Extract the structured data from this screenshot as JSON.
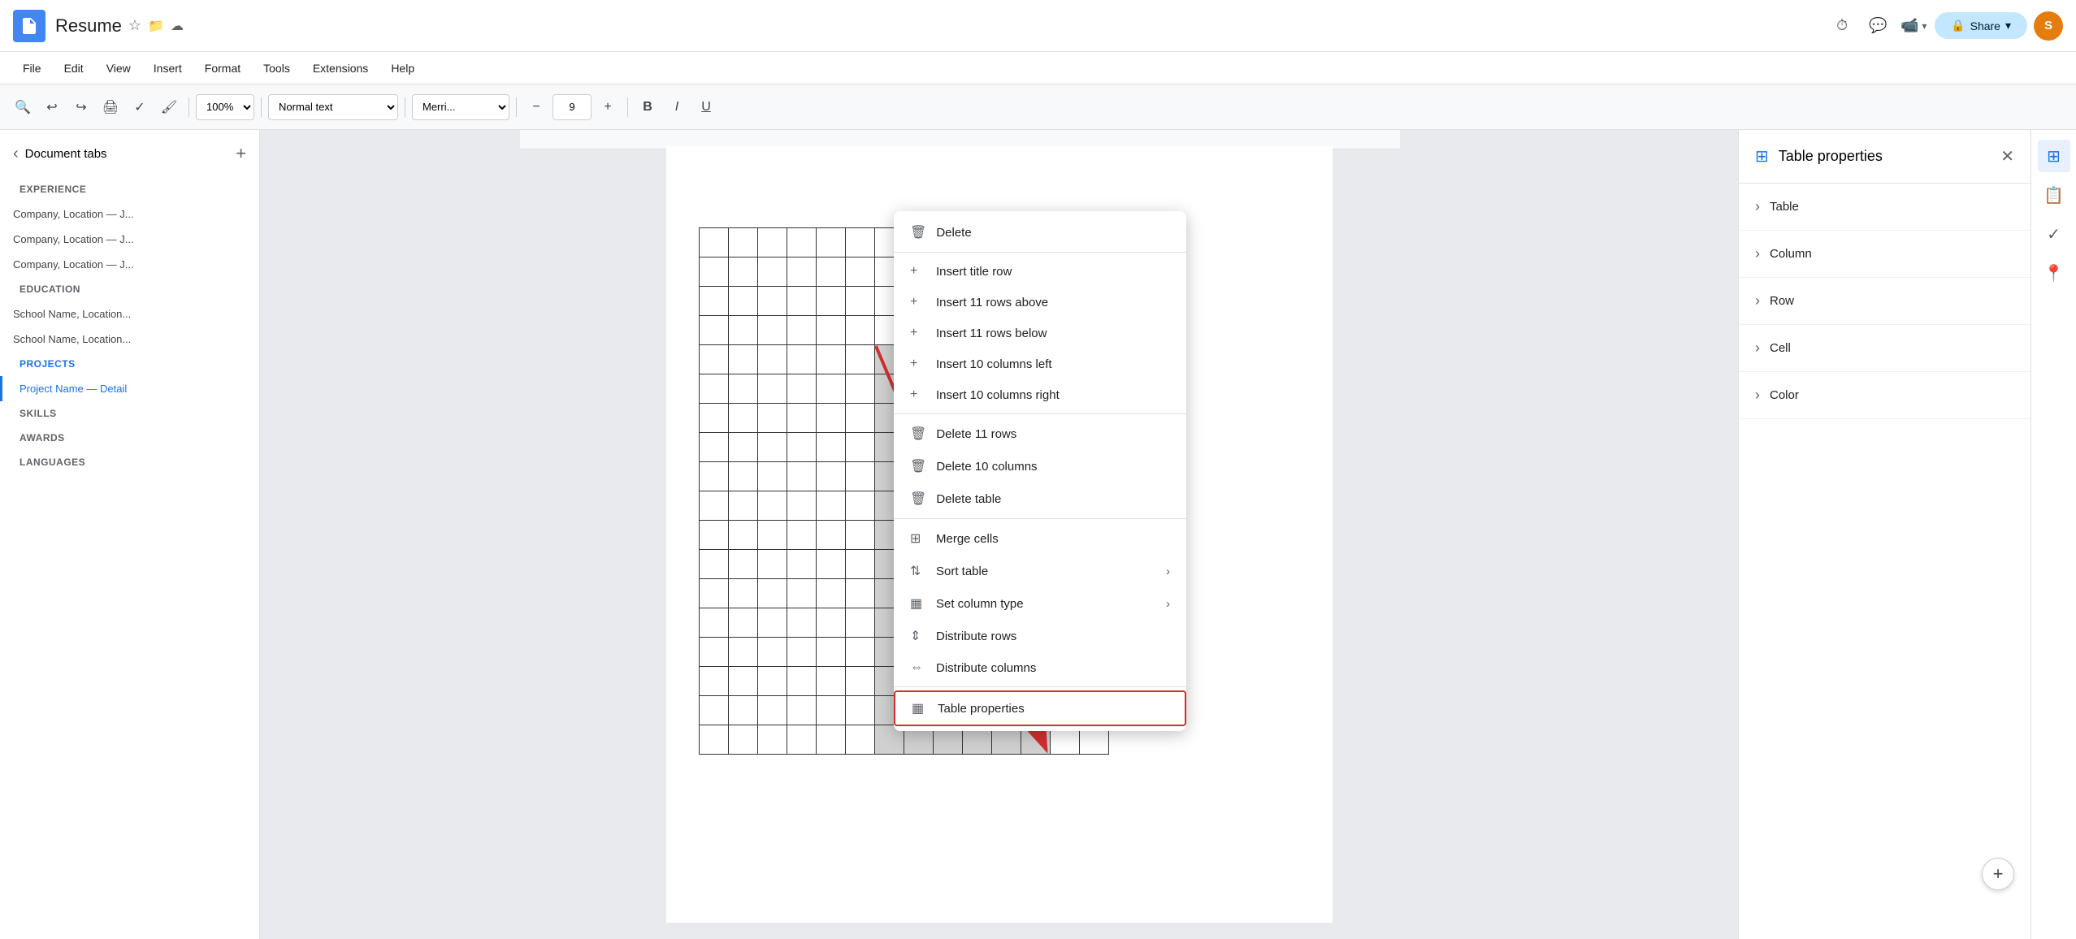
{
  "app": {
    "icon_label": "Google Docs",
    "doc_title": "Resume",
    "cloud_icon": "☁",
    "star_icon": "☆",
    "history_icon": "⊙"
  },
  "top_right": {
    "history_label": "⏱",
    "comment_label": "💬",
    "meet_label": "📹",
    "share_label": "Share",
    "share_dropdown": "▾",
    "avatar_label": "S"
  },
  "menu": {
    "items": [
      "File",
      "Edit",
      "View",
      "Insert",
      "Format",
      "Tools",
      "Extensions",
      "Help"
    ]
  },
  "toolbar": {
    "zoom_label": "100%",
    "style_label": "Normal text",
    "font_label": "Merri...",
    "font_size": "9",
    "bold_label": "B",
    "italic_label": "I",
    "underline_label": "U"
  },
  "sidebar": {
    "title": "Document tabs",
    "sections": [
      {
        "label": "EXPERIENCE",
        "items": [
          "Company, Location — J...",
          "Company, Location — J...",
          "Company, Location — J..."
        ]
      },
      {
        "label": "EDUCATION",
        "items": [
          "School Name, Location...",
          "School Name, Location..."
        ]
      },
      {
        "label": "PROJECTS",
        "items": [
          "Project Name — Detail"
        ],
        "active": true
      },
      {
        "label": "SKILLS",
        "items": []
      },
      {
        "label": "AWARDS",
        "items": []
      },
      {
        "label": "LANGUAGES",
        "items": []
      }
    ]
  },
  "context_menu": {
    "items": [
      {
        "id": "delete",
        "icon": "🗑",
        "label": "Delete",
        "arrow": false
      },
      {
        "id": "insert-title-row",
        "icon": "+",
        "label": "Insert title row",
        "arrow": false
      },
      {
        "id": "insert-rows-above",
        "icon": "+",
        "label": "Insert 11 rows above",
        "arrow": false
      },
      {
        "id": "insert-rows-below",
        "icon": "+",
        "label": "Insert 11 rows below",
        "arrow": false
      },
      {
        "id": "insert-cols-left",
        "icon": "+",
        "label": "Insert 10 columns left",
        "arrow": false
      },
      {
        "id": "insert-cols-right",
        "icon": "+",
        "label": "Insert 10 columns right",
        "arrow": false
      },
      {
        "id": "delete-11-rows",
        "icon": "🗑",
        "label": "Delete 11 rows",
        "arrow": false
      },
      {
        "id": "delete-10-cols",
        "icon": "🗑",
        "label": "Delete 10 columns",
        "arrow": false
      },
      {
        "id": "delete-table",
        "icon": "🗑",
        "label": "Delete table",
        "arrow": false
      },
      {
        "id": "merge-cells",
        "icon": "⊞",
        "label": "Merge cells",
        "arrow": false
      },
      {
        "id": "sort-table",
        "icon": "⇅",
        "label": "Sort table",
        "arrow": true
      },
      {
        "id": "set-column-type",
        "icon": "▦",
        "label": "Set column type",
        "arrow": true
      },
      {
        "id": "distribute-rows",
        "icon": "⇕",
        "label": "Distribute rows",
        "arrow": false
      },
      {
        "id": "distribute-cols",
        "icon": "⇔",
        "label": "Distribute columns",
        "arrow": false
      },
      {
        "id": "table-properties",
        "icon": "▦",
        "label": "Table properties",
        "arrow": false,
        "highlighted": true
      }
    ]
  },
  "right_panel": {
    "title": "Table properties",
    "close_icon": "✕",
    "sections": [
      "Table",
      "Column",
      "Row",
      "Cell",
      "Color"
    ]
  },
  "icon_strip": {
    "icons": [
      {
        "id": "table-icon",
        "symbol": "⊞",
        "active": true
      },
      {
        "id": "notes-icon",
        "symbol": "📄",
        "active": false
      },
      {
        "id": "task-icon",
        "symbol": "✓",
        "active": false
      },
      {
        "id": "maps-icon",
        "symbol": "📍",
        "active": false
      }
    ]
  },
  "table": {
    "rows": 18,
    "cols": 14,
    "selected_start_row": 4,
    "selected_start_col": 6,
    "selected_end_row": 17,
    "selected_end_col": 11
  }
}
